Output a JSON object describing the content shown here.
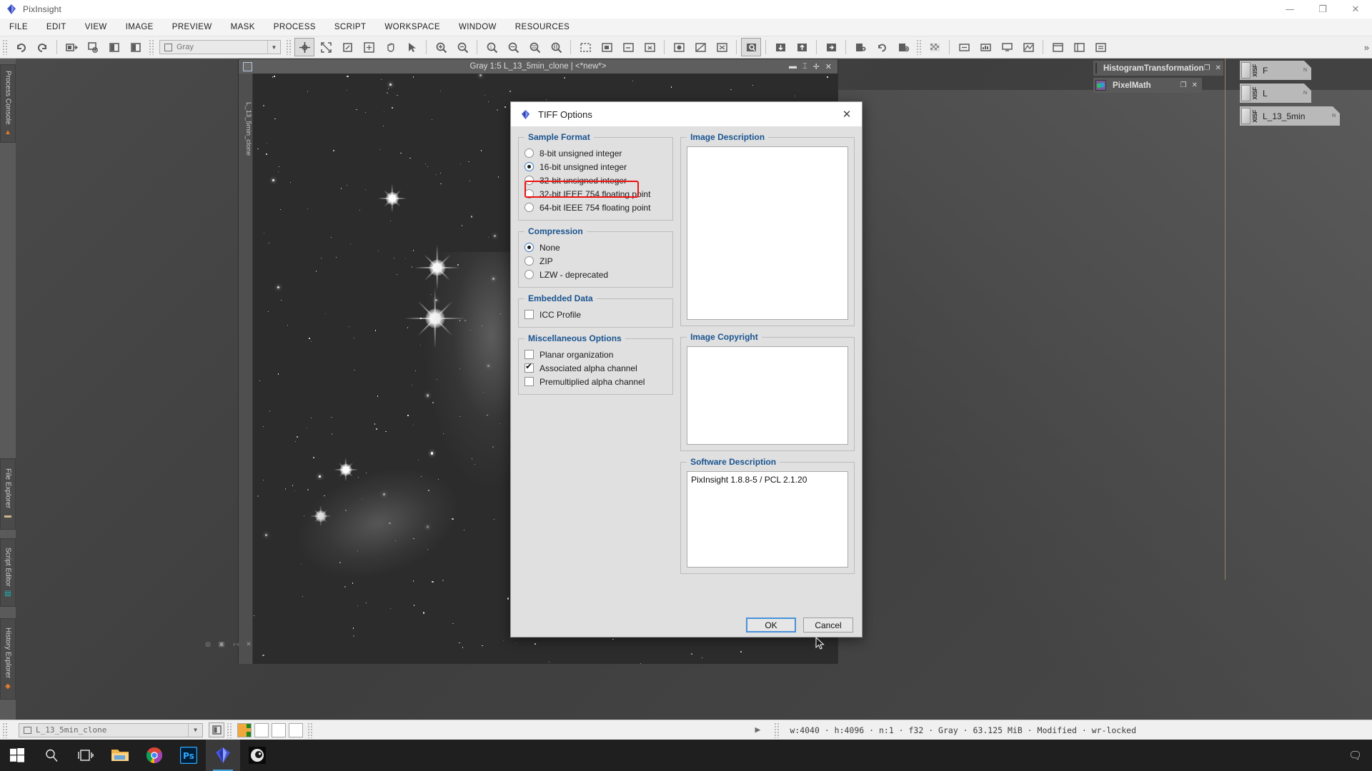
{
  "app": {
    "name": "PixInsight",
    "icon": "pixinsight-logo-icon"
  },
  "window_controls": {
    "minimize": "—",
    "maximize": "❐",
    "close": "✕"
  },
  "menubar": {
    "items": [
      "FILE",
      "EDIT",
      "VIEW",
      "IMAGE",
      "PREVIEW",
      "MASK",
      "PROCESS",
      "SCRIPT",
      "WORKSPACE",
      "WINDOW",
      "RESOURCES"
    ]
  },
  "toolbar": {
    "color_space_value": "Gray",
    "overflow_label": "»"
  },
  "left_dock": {
    "tabs": [
      {
        "label": "Process Console",
        "icon": "console-icon"
      },
      {
        "label": "File Explorer",
        "icon": "folder-icon"
      },
      {
        "label": "Script Editor",
        "icon": "script-icon"
      },
      {
        "label": "History Explorer",
        "icon": "history-icon"
      }
    ]
  },
  "image_window": {
    "title": "Gray 1:5 L_13_5min_clone | <*new*>",
    "side_tab": "L_13_5min_clone",
    "buttons": {
      "minimize": "▬",
      "restore": "⌶",
      "maximize": "✛",
      "close": "✕"
    }
  },
  "process_panel": {
    "items": [
      {
        "label": "HistogramTransformation",
        "icon": "histogram-icon",
        "restore": "❐",
        "close": "✕"
      },
      {
        "label": "PixelMath",
        "icon": "pixelmath-icon",
        "restore": "❐",
        "close": "✕"
      }
    ]
  },
  "file_icons": [
    {
      "format": "XISF",
      "name": "F",
      "badge": "N"
    },
    {
      "format": "XISF",
      "name": "L",
      "badge": "N"
    },
    {
      "format": "XISF",
      "name": "L_13_5min",
      "badge": "N"
    }
  ],
  "dialog": {
    "title": "TIFF Options",
    "icon": "pixinsight-logo-icon",
    "close": "✕",
    "sample_format": {
      "legend": "Sample Format",
      "options": [
        {
          "label": "8-bit unsigned integer",
          "selected": false
        },
        {
          "label": "16-bit unsigned integer",
          "selected": true
        },
        {
          "label": "32-bit unsigned integer",
          "selected": false
        },
        {
          "label": "32-bit IEEE 754 floating point",
          "selected": false
        },
        {
          "label": "64-bit IEEE 754 floating point",
          "selected": false
        }
      ],
      "highlight_color": "#ee1111",
      "highlighted_option": "16-bit unsigned integer"
    },
    "compression": {
      "legend": "Compression",
      "options": [
        {
          "label": "None",
          "selected": true
        },
        {
          "label": "ZIP",
          "selected": false
        },
        {
          "label": "LZW - deprecated",
          "selected": false
        }
      ]
    },
    "embedded_data": {
      "legend": "Embedded Data",
      "options": [
        {
          "label": "ICC Profile",
          "checked": false
        }
      ]
    },
    "misc_options": {
      "legend": "Miscellaneous Options",
      "options": [
        {
          "label": "Planar organization",
          "checked": false
        },
        {
          "label": "Associated alpha channel",
          "checked": true
        },
        {
          "label": "Premultiplied alpha channel",
          "checked": false
        }
      ]
    },
    "image_description": {
      "legend": "Image Description",
      "value": ""
    },
    "image_copyright": {
      "legend": "Image Copyright",
      "value": ""
    },
    "software_description": {
      "legend": "Software Description",
      "value": "PixInsight 1.8.8-5 / PCL 2.1.20"
    },
    "buttons": {
      "ok": "OK",
      "cancel": "Cancel"
    }
  },
  "statusbar": {
    "view_selector_value": "L_13_5min_clone",
    "info": "w:4040 · h:4096 · n:1 · f32 · Gray · 63.125 MiB · Modified · wr-locked"
  },
  "taskbar": {
    "items": [
      {
        "name": "start-button",
        "icon": "windows-icon"
      },
      {
        "name": "search-button",
        "icon": "search-icon"
      },
      {
        "name": "task-view-button",
        "icon": "task-view-icon"
      },
      {
        "name": "file-explorer-button",
        "icon": "folder-icon"
      },
      {
        "name": "chrome-button",
        "icon": "chrome-icon"
      },
      {
        "name": "photoshop-button",
        "icon": "photoshop-icon"
      },
      {
        "name": "pixinsight-button",
        "icon": "pixinsight-icon"
      },
      {
        "name": "media-player-button",
        "icon": "media-player-icon"
      }
    ],
    "tray": "🗨"
  }
}
